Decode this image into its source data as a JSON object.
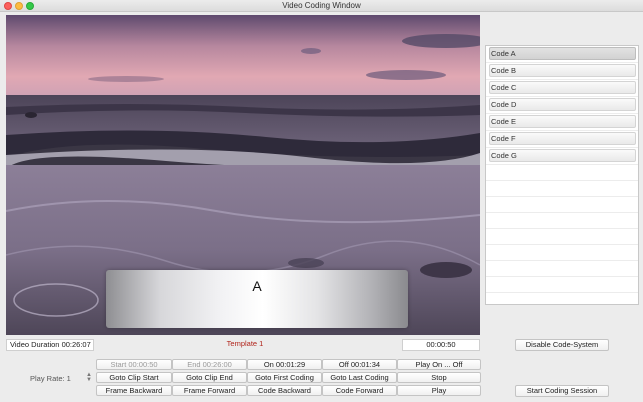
{
  "window": {
    "title": "Video Coding Window"
  },
  "video": {
    "overlay_text": "A"
  },
  "codes": [
    "Code A",
    "Code B",
    "Code C",
    "Code D",
    "Code E",
    "Code F",
    "Code G"
  ],
  "selected_code": "Code A",
  "status": {
    "duration": "Video Duration 00:26:07",
    "template": "Template 1",
    "clock": "00:00:50"
  },
  "right_buttons": {
    "disable": "Disable Code-System",
    "start_session": "Start Coding Session"
  },
  "play_rate": {
    "label": "Play Rate: 1"
  },
  "controls": {
    "row1": [
      {
        "label": "Start 00:00:50",
        "disabled": true
      },
      {
        "label": "End 00:26:00",
        "disabled": true
      },
      {
        "label": "On 00:01:29",
        "disabled": false
      },
      {
        "label": "Off 00:01:34",
        "disabled": false
      },
      {
        "label": "Play On ... Off",
        "disabled": false
      }
    ],
    "row2": [
      "Goto Clip Start",
      "Goto Clip End",
      "Goto First Coding",
      "Goto Last Coding",
      "Stop"
    ],
    "row3": [
      "Frame Backward",
      "Frame Forward",
      "Code Backward",
      "Code Forward",
      "Play"
    ]
  },
  "colors": {
    "template_red": "#b1251c",
    "accent_selected": "#d2d2d2"
  }
}
